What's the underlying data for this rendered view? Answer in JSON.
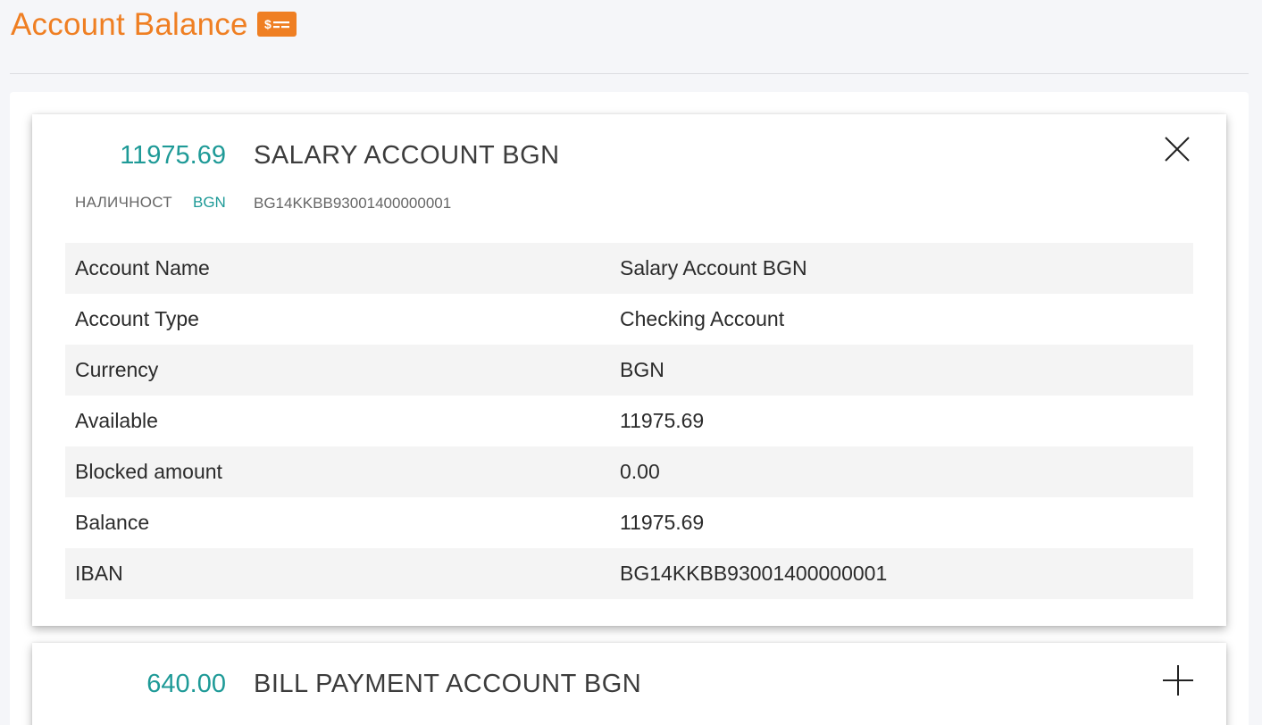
{
  "page": {
    "title": "Account Balance",
    "title_icon": "money-check-icon",
    "accent_color": "#ef7f23",
    "teal_color": "#1e9a97"
  },
  "accounts": [
    {
      "amount": "11975.69",
      "name": "SALARY ACCOUNT BGN",
      "status_label": "НАЛИЧНОСТ",
      "currency": "BGN",
      "iban": "BG14KKBB93001400000001",
      "expanded": true,
      "toggle_icon": "close-icon",
      "details": [
        {
          "label": "Account Name",
          "value": "Salary Account BGN"
        },
        {
          "label": "Account Type",
          "value": "Checking Account"
        },
        {
          "label": "Currency",
          "value": "BGN"
        },
        {
          "label": "Available",
          "value": "11975.69"
        },
        {
          "label": "Blocked amount",
          "value": "0.00"
        },
        {
          "label": "Balance",
          "value": "11975.69"
        },
        {
          "label": "IBAN",
          "value": "BG14KKBB93001400000001"
        }
      ]
    },
    {
      "amount": "640.00",
      "name": "BILL PAYMENT ACCOUNT BGN",
      "expanded": false,
      "toggle_icon": "plus-icon"
    }
  ]
}
